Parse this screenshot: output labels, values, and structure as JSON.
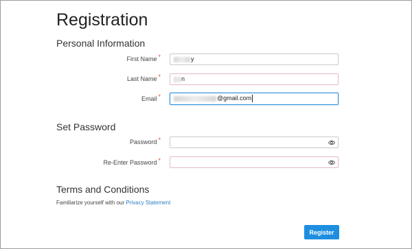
{
  "page": {
    "title": "Registration"
  },
  "personal": {
    "heading": "Personal Information",
    "first_name": {
      "label": "First Name",
      "value_suffix": "y"
    },
    "last_name": {
      "label": "Last Name",
      "value_suffix": "n"
    },
    "email": {
      "label": "Email",
      "value_suffix": "@gmail.com"
    }
  },
  "password": {
    "heading": "Set Password",
    "password": {
      "label": "Password",
      "icon": "eye-icon"
    },
    "reenter": {
      "label": "Re-Enter Password",
      "icon": "eye-icon"
    }
  },
  "terms": {
    "heading": "Terms and Conditions",
    "text": "Familiarize yourself with our",
    "link": "Privacy Statement"
  },
  "required_mark": "*",
  "actions": {
    "register_label": "Register"
  },
  "colors": {
    "accent": "#1e8fe0",
    "required": "#e0502a",
    "link": "#2b7fc4",
    "focus_border": "#2b8fd6"
  }
}
